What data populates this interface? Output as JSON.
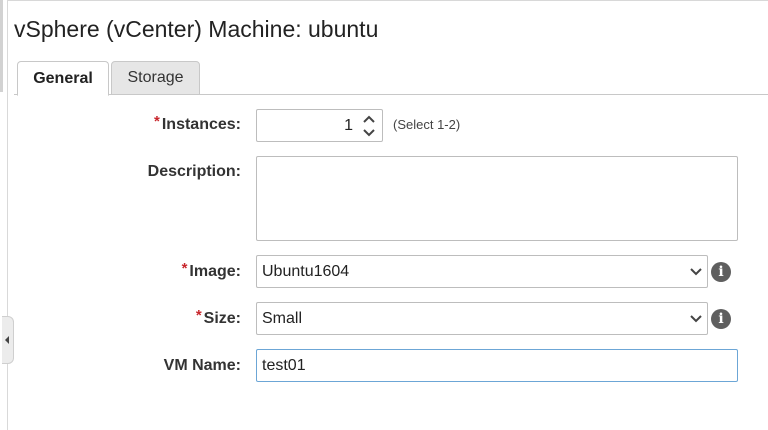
{
  "window": {
    "title": "vSphere (vCenter) Machine: ubuntu"
  },
  "tabs": [
    {
      "label": "General",
      "active": true
    },
    {
      "label": "Storage",
      "active": false
    }
  ],
  "form": {
    "instances": {
      "label": "Instances:",
      "required": true,
      "value": "1",
      "hint": "(Select 1-2)"
    },
    "description": {
      "label": "Description:",
      "value": ""
    },
    "image": {
      "label": "Image:",
      "required": true,
      "value": "Ubuntu1604",
      "info_icon": "info-icon"
    },
    "size": {
      "label": "Size:",
      "required": true,
      "value": "Small",
      "info_icon": "info-icon"
    },
    "vm_name": {
      "label": "VM Name:",
      "value": "test01"
    }
  },
  "required_marker": "*",
  "colors": {
    "required": "#c8262c",
    "focus_border": "#6ca6d6",
    "inactive_tab": "#e6e6e6"
  }
}
